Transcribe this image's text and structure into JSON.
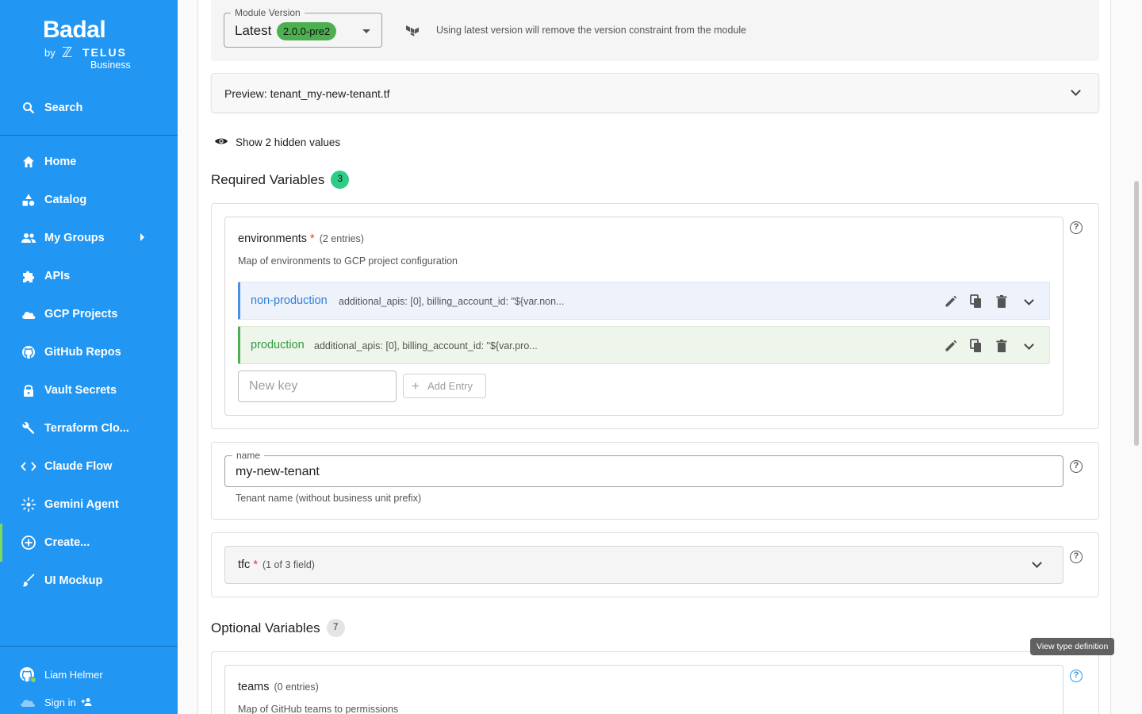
{
  "brand": {
    "name": "Badal",
    "by": "by",
    "partner": "TELUS",
    "partner_sub": "Business"
  },
  "sidebar": {
    "search_label": "Search",
    "items": [
      {
        "label": "Home",
        "icon": "home-icon"
      },
      {
        "label": "Catalog",
        "icon": "shapes-icon"
      },
      {
        "label": "My Groups",
        "icon": "people-icon"
      },
      {
        "label": "APIs",
        "icon": "puzzle-icon"
      },
      {
        "label": "GCP Projects",
        "icon": "cloud-icon"
      },
      {
        "label": "GitHub Repos",
        "icon": "github-icon"
      },
      {
        "label": "Vault Secrets",
        "icon": "lock-icon"
      },
      {
        "label": "Terraform Clo...",
        "icon": "wrench-icon"
      },
      {
        "label": "Claude Flow",
        "icon": "code-icon"
      },
      {
        "label": "Gemini Agent",
        "icon": "sparkle-icon"
      },
      {
        "label": "Create...",
        "icon": "add-circle-icon"
      },
      {
        "label": "UI Mockup",
        "icon": "brush-icon"
      }
    ],
    "user_name": "Liam Helmer",
    "sign_in_label": "Sign in"
  },
  "module_version": {
    "legend": "Module Version",
    "value": "Latest",
    "chip": "2.0.0-pre2",
    "note": "Using latest version will remove the version constraint from the module"
  },
  "preview": {
    "label": "Preview: tenant_my-new-tenant.tf"
  },
  "hidden_toggle": "Show 2 hidden values",
  "required": {
    "title": "Required Variables",
    "count": "3",
    "environments": {
      "name": "environments",
      "star": "*",
      "meta": "(2 entries)",
      "description": "Map of environments to GCP project configuration",
      "entries": [
        {
          "key": "non-production",
          "summary": "additional_apis: [0], billing_account_id: \"${var.non..."
        },
        {
          "key": "production",
          "summary": "additional_apis: [0], billing_account_id: \"${var.pro..."
        }
      ],
      "new_key_placeholder": "New key",
      "add_entry_label": "Add Entry"
    },
    "name_field": {
      "legend": "name",
      "value": "my-new-tenant",
      "description": "Tenant name (without business unit prefix)"
    },
    "tfc": {
      "name": "tfc",
      "star": "*",
      "meta": "(1 of 3 field)"
    }
  },
  "optional": {
    "title": "Optional Variables",
    "count": "7",
    "teams": {
      "name": "teams",
      "meta": "(0 entries)",
      "description": "Map of GitHub teams to permissions"
    }
  },
  "tooltip": "View type definition",
  "colors": {
    "sidebar": "#2196f3",
    "accent_green": "#4caf50",
    "required_badge": "#2ecc87"
  }
}
